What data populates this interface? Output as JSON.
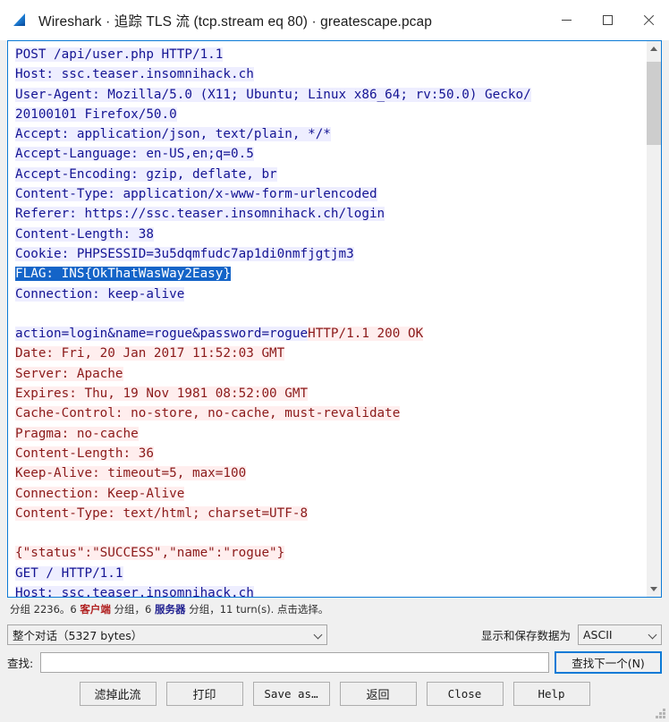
{
  "window": {
    "title": "Wireshark · 追踪 TLS 流 (tcp.stream eq 80) · greatescape.pcap",
    "icon": "wireshark-fin-icon",
    "accent_color": "#0b7ad6",
    "controls": {
      "minimize": "minimize-icon",
      "maximize": "maximize-icon",
      "close": "close-icon"
    }
  },
  "stream": {
    "lines": [
      {
        "kind": "req",
        "text": "POST /api/user.php HTTP/1.1"
      },
      {
        "kind": "req",
        "text": "Host: ssc.teaser.insomnihack.ch"
      },
      {
        "kind": "req",
        "text": "User-Agent: Mozilla/5.0 (X11; Ubuntu; Linux x86_64; rv:50.0) Gecko/"
      },
      {
        "kind": "req",
        "text": "20100101 Firefox/50.0"
      },
      {
        "kind": "req",
        "text": "Accept: application/json, text/plain, */*"
      },
      {
        "kind": "req",
        "text": "Accept-Language: en-US,en;q=0.5"
      },
      {
        "kind": "req",
        "text": "Accept-Encoding: gzip, deflate, br"
      },
      {
        "kind": "req",
        "text": "Content-Type: application/x-www-form-urlencoded"
      },
      {
        "kind": "req",
        "text": "Referer: https://ssc.teaser.insomnihack.ch/login"
      },
      {
        "kind": "req",
        "text": "Content-Length: 38"
      },
      {
        "kind": "req",
        "text": "Cookie: PHPSESSID=3u5dqmfudc7ap1di0nmfjgtjm3"
      },
      {
        "kind": "sel",
        "text": "FLAG: INS{OkThatWasWay2Easy}"
      },
      {
        "kind": "req",
        "text": "Connection: keep-alive"
      },
      {
        "kind": "blank",
        "text": ""
      },
      {
        "kind": "mixed",
        "segments": [
          {
            "kind": "req",
            "text": "action=login&name=rogue&password=rogue"
          },
          {
            "kind": "resp",
            "text": "HTTP/1.1 200 OK"
          }
        ]
      },
      {
        "kind": "resp",
        "text": "Date: Fri, 20 Jan 2017 11:52:03 GMT"
      },
      {
        "kind": "resp",
        "text": "Server: Apache"
      },
      {
        "kind": "resp",
        "text": "Expires: Thu, 19 Nov 1981 08:52:00 GMT"
      },
      {
        "kind": "resp",
        "text": "Cache-Control: no-store, no-cache, must-revalidate"
      },
      {
        "kind": "resp",
        "text": "Pragma: no-cache"
      },
      {
        "kind": "resp",
        "text": "Content-Length: 36"
      },
      {
        "kind": "resp",
        "text": "Keep-Alive: timeout=5, max=100"
      },
      {
        "kind": "resp",
        "text": "Connection: Keep-Alive"
      },
      {
        "kind": "resp",
        "text": "Content-Type: text/html; charset=UTF-8"
      },
      {
        "kind": "blank",
        "text": ""
      },
      {
        "kind": "resp",
        "text": "{\"status\":\"SUCCESS\",\"name\":\"rogue\"}"
      },
      {
        "kind": "req",
        "text": "GET / HTTP/1.1"
      },
      {
        "kind": "req",
        "text": "Host: ssc.teaser.insomnihack.ch"
      }
    ],
    "colors": {
      "request_text": "#141493",
      "request_bg": "#eeeeff",
      "response_text": "#8b1a1a",
      "response_bg": "#ffeeee",
      "selection_text": "#ffffff",
      "selection_bg": "#1464c8"
    },
    "scrollbar": {
      "up_icon": "chevron-up-icon",
      "down_icon": "chevron-down-icon"
    }
  },
  "status": {
    "part1": "分组 2236。6 ",
    "client": "客户端",
    "part2": " 分组，6 ",
    "server": "服务器",
    "part3": " 分组，11 turn(s). 点击选择。"
  },
  "controls": {
    "stream_select": {
      "value": "整个对话（5327 bytes）",
      "chevron": "chevron-down-icon"
    },
    "show_as_label": "显示和保存数据为",
    "encoding_select": {
      "value": "ASCII",
      "chevron": "chevron-down-icon"
    },
    "find_label": "查找:",
    "find_value": "",
    "find_placeholder": "",
    "find_next_label": "查找下一个(N)"
  },
  "buttons": [
    {
      "label": "滤掉此流",
      "mono": false
    },
    {
      "label": "打印",
      "mono": false
    },
    {
      "label": "Save as…",
      "mono": true
    },
    {
      "label": "返回",
      "mono": false
    },
    {
      "label": "Close",
      "mono": true
    },
    {
      "label": "Help",
      "mono": true
    }
  ]
}
